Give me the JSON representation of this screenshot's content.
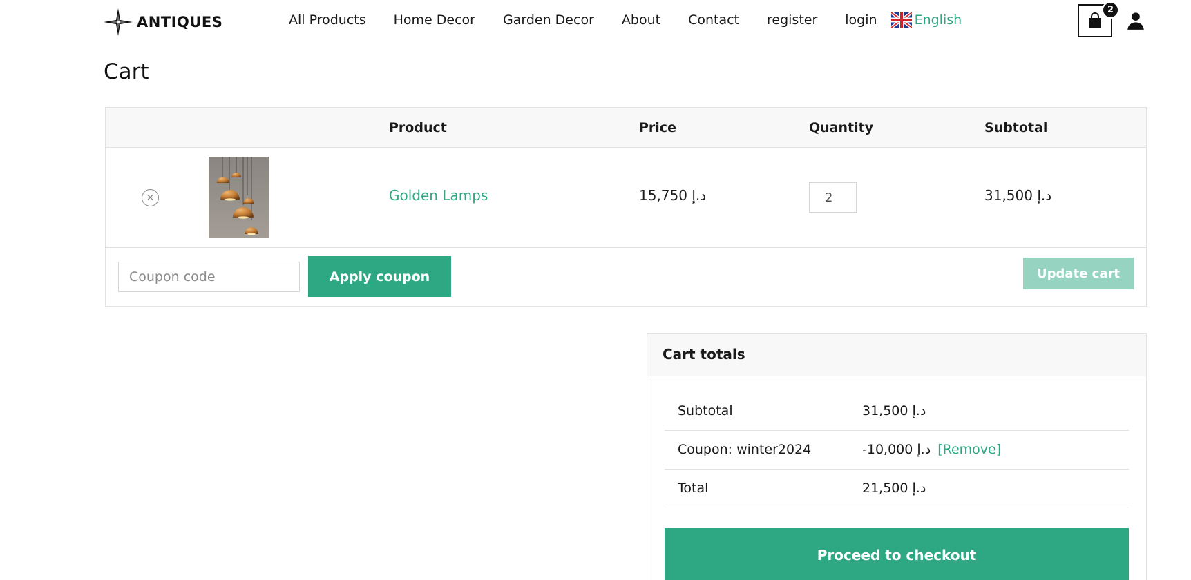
{
  "header": {
    "brand": "ANTIQUES",
    "logo_icon": "compass-star-icon",
    "nav": [
      {
        "label": "All Products"
      },
      {
        "label": "Home Decor"
      },
      {
        "label": "Garden Decor"
      },
      {
        "label": "About"
      },
      {
        "label": "Contact"
      },
      {
        "label": "register"
      },
      {
        "label": "login"
      }
    ],
    "language": {
      "label": "English",
      "flag_icon": "uk-flag-icon"
    },
    "cart": {
      "count": "2",
      "icon": "shopping-bag-icon"
    },
    "account_icon": "user-icon"
  },
  "page": {
    "title": "Cart"
  },
  "cart_table": {
    "columns": {
      "product": "Product",
      "price": "Price",
      "quantity": "Quantity",
      "subtotal": "Subtotal"
    },
    "items": [
      {
        "name": "Golden Lamps",
        "price": "د.إ 15,750",
        "quantity": "2",
        "subtotal": "د.إ 31,500",
        "image_alt": "Golden Lamps"
      }
    ],
    "coupon": {
      "placeholder": "Coupon code",
      "value": ""
    },
    "apply_label": "Apply coupon",
    "update_label": "Update cart"
  },
  "totals": {
    "title": "Cart totals",
    "subtotal": {
      "label": "Subtotal",
      "value": "د.إ 31,500"
    },
    "coupon": {
      "label": "Coupon: winter2024",
      "value": "-د.إ 10,000",
      "remove_label": "[Remove]"
    },
    "total": {
      "label": "Total",
      "value": "د.إ 21,500"
    },
    "checkout_label": "Proceed to checkout"
  },
  "colors": {
    "accent": "#2ea883",
    "accent_disabled": "#96d4c1",
    "border": "#e2e2e2",
    "header_bg": "#f8f8f8"
  }
}
